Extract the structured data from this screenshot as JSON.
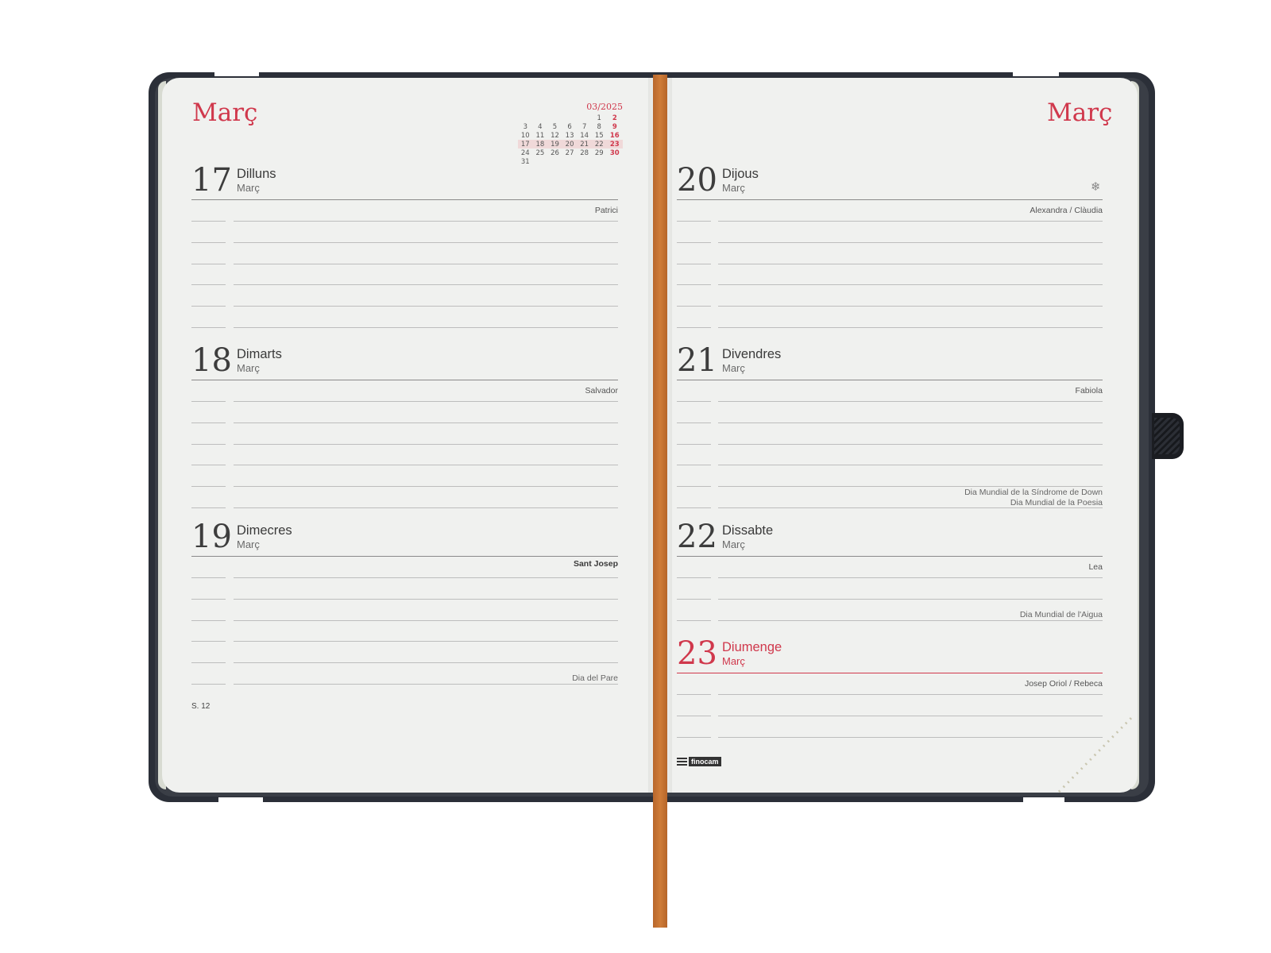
{
  "left_page": {
    "month_title": "Març",
    "mini_calendar": {
      "header": "03/2025",
      "weeks": [
        [
          "",
          "",
          "",
          "",
          "",
          "1",
          "2"
        ],
        [
          "3",
          "4",
          "5",
          "6",
          "7",
          "8",
          "9"
        ],
        [
          "10",
          "11",
          "12",
          "13",
          "14",
          "15",
          "16"
        ],
        [
          "17",
          "18",
          "19",
          "20",
          "21",
          "22",
          "23"
        ],
        [
          "24",
          "25",
          "26",
          "27",
          "28",
          "29",
          "30"
        ],
        [
          "31",
          "",
          "",
          "",
          "",
          "",
          ""
        ]
      ]
    },
    "days": [
      {
        "number": "17",
        "name": "Dilluns",
        "month": "Març",
        "saint": "Patrici"
      },
      {
        "number": "18",
        "name": "Dimarts",
        "month": "Març",
        "saint": "Salvador"
      },
      {
        "number": "19",
        "name": "Dimecres",
        "month": "Març",
        "saint": "Sant Josep",
        "note": "Dia del Pare"
      }
    ],
    "week_label": "S. 12"
  },
  "right_page": {
    "month_title": "Març",
    "days": [
      {
        "number": "20",
        "name": "Dijous",
        "month": "Març",
        "saint": "Alexandra / Clàudia",
        "icon": "snowflake-icon"
      },
      {
        "number": "21",
        "name": "Divendres",
        "month": "Març",
        "saint": "Fabiola",
        "note_line1": "Dia Mundial de la Síndrome de Down",
        "note_line2": "Dia Mundial de la Poesia"
      },
      {
        "number": "22",
        "name": "Dissabte",
        "month": "Març",
        "saint": "Lea",
        "note": "Dia Mundial de l'Aigua"
      },
      {
        "number": "23",
        "name": "Diumenge",
        "month": "Març",
        "saint": "Josep Oriol / Rebeca"
      }
    ],
    "brand": "finocam"
  },
  "colors": {
    "accent_red": "#d0384c",
    "cover": "#2b2f38",
    "ribbon": "#c8733a",
    "page": "#f0f1ef"
  }
}
